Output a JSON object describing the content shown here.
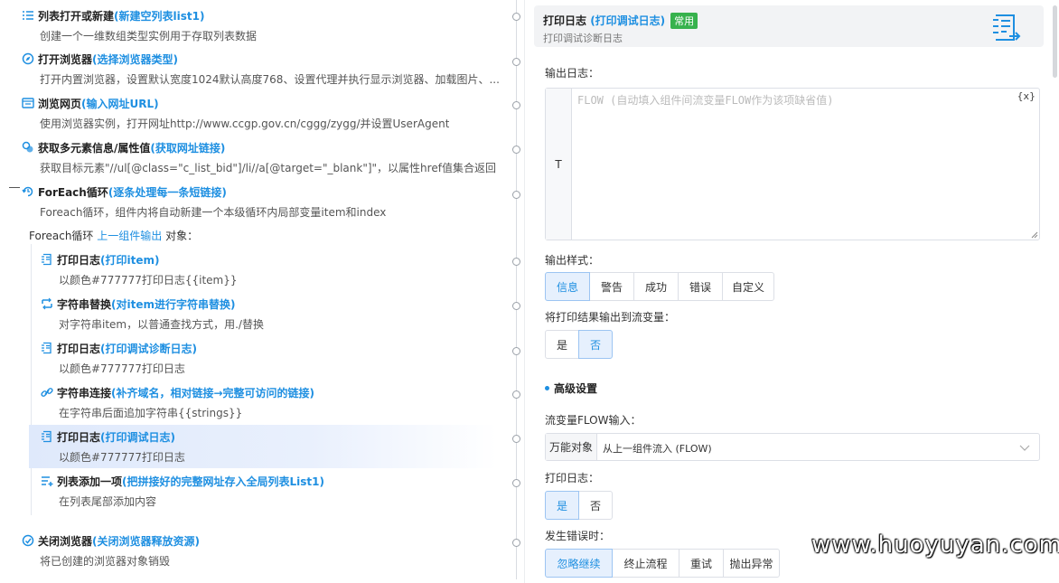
{
  "flow": {
    "steps": [
      {
        "icon": "list-icon",
        "title": "列表打开或新建",
        "sub": "(新建空列表list1)",
        "desc": "创建一个一维数组类型实例用于存取列表数据"
      },
      {
        "icon": "compass-icon",
        "title": "打开浏览器",
        "sub": "(选择浏览器类型)",
        "desc": "打开内置浏览器，设置默认宽度1024默认高度768、设置代理并执行显示浏览器、加载图片、..."
      },
      {
        "icon": "browser-icon",
        "title": "浏览网页",
        "sub": "(输入网址URL)",
        "desc": "使用浏览器实例，打开网址http://www.ccgp.gov.cn/cggg/zygg/并设置UserAgent"
      },
      {
        "icon": "elements-icon",
        "title": "获取多元素信息/属性值",
        "sub": "(获取网址链接)",
        "desc": "获取目标元素\"//ul[@class=\"c_list_bid\"]/li//a[@target=\"_blank\"]\"，以属性href值集合返回"
      },
      {
        "icon": "loop-icon",
        "title": "ForEach循环",
        "sub": " (逐条处理每一条短链接)",
        "desc": "Foreach循环，组件内将自动新建一个本级循环内局部变量item和index"
      },
      {
        "icon": "log-icon",
        "title": "打印日志",
        "sub": "(打印item)",
        "desc": "以颜色#777777打印日志{{item}}"
      },
      {
        "icon": "replace-icon",
        "title": "字符串替换",
        "sub": "(对item进行字符串替换)",
        "desc": "对字符串item，以普通查找方式，用./替换"
      },
      {
        "icon": "log-icon",
        "title": "打印日志",
        "sub": "(打印调试诊断日志)",
        "desc": "以颜色#777777打印日志"
      },
      {
        "icon": "link-icon",
        "title": "字符串连接",
        "sub": "(补齐域名，相对链接→完整可访问的链接)",
        "desc": "在字符串后面追加字符串{{strings}}"
      },
      {
        "icon": "log-icon",
        "title": "打印日志",
        "sub": "(打印调试日志)",
        "desc": "以颜色#777777打印日志"
      },
      {
        "icon": "list-add-icon",
        "title": "列表添加一项",
        "sub": "(把拼接好的完整网址存入全局列表List1)",
        "desc": "在列表尾部添加内容"
      },
      {
        "icon": "close-browser-icon",
        "title": "关闭浏览器",
        "sub": "(关闭浏览器释放资源)",
        "desc": "将已创建的浏览器对象销毁"
      }
    ],
    "foreach_head": {
      "prefix": "Foreach循环",
      "link": "上一组件输出",
      "suffix": " 对象："
    }
  },
  "panel": {
    "title": "打印日志",
    "title_sub": " (打印调试日志)",
    "badge": "常用",
    "desc": "打印调试诊断日志",
    "output_label": "输出日志：",
    "type_marker": "T",
    "placeholder": "FLOW (自动填入组件间流变量FLOW作为该项缺省值)",
    "var_button": "{x}",
    "style_label": "输出样式：",
    "style_options": [
      "信息",
      "警告",
      "成功",
      "错误",
      "自定义"
    ],
    "style_selected": "信息",
    "to_var_label": "将打印结果输出到流变量：",
    "to_var_options": [
      "是",
      "否"
    ],
    "to_var_selected": "否",
    "advanced_title": "高级设置",
    "flow_input_label": "流变量FLOW输入：",
    "flow_input_prefix": "万能对象",
    "flow_input_value": "从上一组件流入 (FLOW)",
    "print_label": "打印日志：",
    "print_options": [
      "是",
      "否"
    ],
    "print_selected": "是",
    "error_label": "发生错误时：",
    "error_options": [
      "忽略继续",
      "终止流程",
      "重试",
      "抛出异常"
    ],
    "error_selected": "忽略继续"
  },
  "watermark": "www.huoyuyan.com",
  "colors": {
    "accent": "#1e8fe1",
    "badge": "#37b24d",
    "selected_bg": "#e6f0fd"
  }
}
